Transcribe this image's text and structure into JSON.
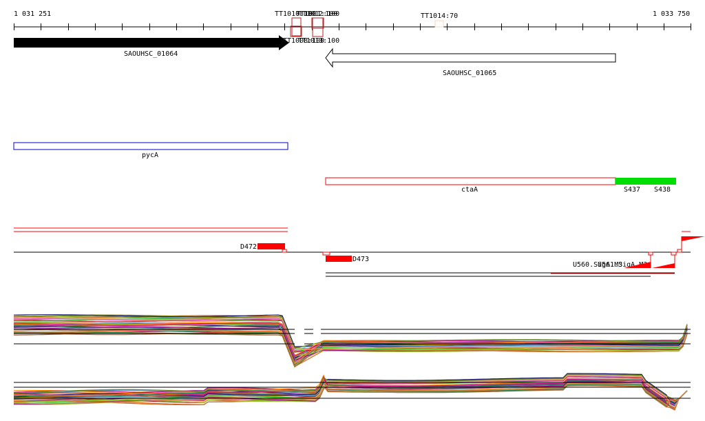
{
  "ruler": {
    "start_label": "1 031 251",
    "end_label": "1 033 750",
    "start": 1031251,
    "end": 1033750,
    "tick_step": 100
  },
  "terminators": [
    {
      "label": "TT1010:100",
      "pos": 1032250
    },
    {
      "label": "TT1011:100",
      "pos": 1032300
    },
    {
      "label": "TT1012:100",
      "pos": 1032330
    },
    {
      "label": "TT1008:100",
      "pos": 1032240
    },
    {
      "label": "TT1013:100",
      "pos": 1032320
    },
    {
      "label": "TT1014:70",
      "pos": 1032820
    }
  ],
  "genes": [
    {
      "label": "SAOUHSC_01064",
      "from": 1031251,
      "to": 1032251,
      "strand": "+",
      "filled": true
    },
    {
      "label": "SAOUHSC_01065",
      "from": 1032385,
      "to": 1033435,
      "strand": "-",
      "filled": false
    }
  ],
  "features": [
    {
      "label": "pycA",
      "from": 1031251,
      "to": 1032251,
      "color": "#0000cc"
    },
    {
      "label": "ctaA",
      "from": 1032385,
      "to": 1033435,
      "color": "#ff0000"
    }
  ],
  "segments": [
    {
      "label": "S437",
      "from": 1033435,
      "to": 1033650
    },
    {
      "label": "S438",
      "from": 1033650,
      "to": 1033655
    }
  ],
  "tss_labels": [
    "D472",
    "D473",
    "U560.SigA.M3",
    "U561.SigA.M3"
  ],
  "trace_colors": [
    "#8b0a8b",
    "#ff6347",
    "#6b8e23",
    "#cd853f",
    "#4682b4",
    "#32cd32",
    "#b22222",
    "#d2691e",
    "#87ceeb",
    "#808000",
    "#da70d6",
    "#a0522d",
    "#191970",
    "#ff8c00",
    "#9acd32",
    "#c71585",
    "#2e8b57",
    "#f4a460"
  ]
}
